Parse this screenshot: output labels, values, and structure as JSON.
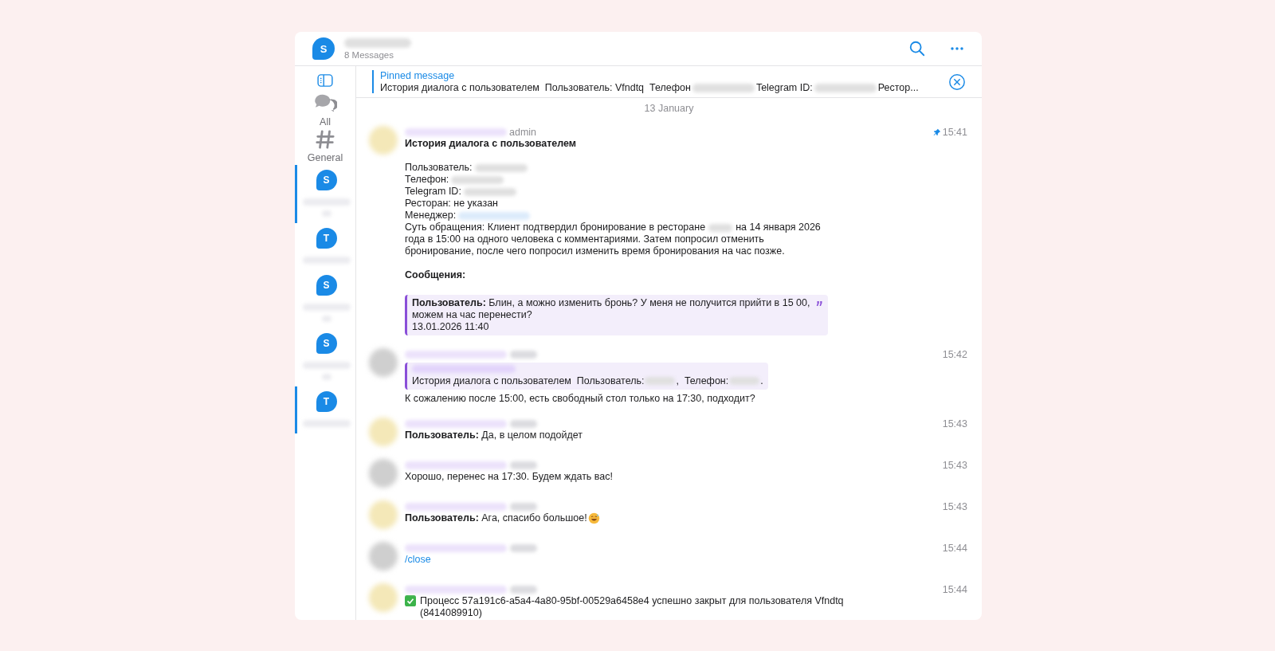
{
  "header": {
    "avatar_letter": "S",
    "subtitle": "8 Messages"
  },
  "sidebar": {
    "filters": [
      {
        "kind": "all",
        "label": "All"
      },
      {
        "kind": "general",
        "label": "General"
      }
    ],
    "topics": [
      {
        "letter": "S",
        "selected": true,
        "kind": "double"
      },
      {
        "letter": "T",
        "selected": false,
        "kind": "single"
      },
      {
        "letter": "S",
        "selected": false,
        "kind": "double"
      },
      {
        "letter": "S",
        "selected": false,
        "kind": "double"
      },
      {
        "letter": "T",
        "selected": true,
        "kind": "single"
      }
    ]
  },
  "pinned": {
    "label": "Pinned message",
    "segments": [
      "История диалога с пользователем  Пользователь: Vfndtq  Телефон",
      "Telegram ID:",
      "Рестор..."
    ]
  },
  "date_separator": "13 January",
  "messages": [
    {
      "color": "#f4e8b8",
      "role": "admin",
      "time": "15:41",
      "pinned": true,
      "body": [
        {
          "kind": "bold",
          "text": "История диалога с пользователем"
        },
        {
          "kind": "gap"
        },
        {
          "kind": "field",
          "text": "Пользователь:"
        },
        {
          "kind": "field",
          "text": "Телефон:"
        },
        {
          "kind": "field",
          "text": "Telegram ID:"
        },
        {
          "kind": "text",
          "text": "Ресторан: не указан"
        },
        {
          "kind": "field-link",
          "text": "Менеджер:"
        },
        {
          "kind": "split",
          "before": "Суть обращения: Клиент подтвердил бронирование в ресторане",
          "after": "на 14 января 2026",
          "continued": "года в 15:00 на одного человека с комментариями. Затем попросил отменить бронирование, после чего попросил изменить время бронирования на час позже."
        },
        {
          "kind": "gap"
        },
        {
          "kind": "bold",
          "text": "Сообщения:"
        },
        {
          "kind": "gap"
        },
        {
          "kind": "quote",
          "text": "**Пользователь:** Блин, а можно изменить бронь? У меня не получится прийти в 15 00, можем на час перенести?",
          "date": "13.01.2026 11:40"
        }
      ]
    },
    {
      "color": "#cfcfcf",
      "time": "15:42",
      "pinned": false,
      "reply": {
        "segments": [
          "История диалога с пользователем  Пользователь:",
          ",  Телефон:",
          "."
        ]
      },
      "body": [
        {
          "kind": "text",
          "text": "К сожалению после 15:00, есть свободный стол только на 17:30, подходит?"
        }
      ]
    },
    {
      "color": "#f4e8b8",
      "time": "15:43",
      "pinned": false,
      "body": [
        {
          "kind": "rich",
          "text": "**Пользователь:** Да, в целом подойдет"
        }
      ]
    },
    {
      "color": "#cfcfcf",
      "time": "15:43",
      "pinned": false,
      "body": [
        {
          "kind": "text",
          "text": "Хорошо, перенес на 17:30. Будем ждать вас!"
        }
      ]
    },
    {
      "color": "#f4e8b8",
      "time": "15:43",
      "pinned": false,
      "body": [
        {
          "kind": "emoji",
          "text": "**Пользователь:** Ага, спасибо большое!"
        }
      ]
    },
    {
      "color": "#cfcfcf",
      "time": "15:44",
      "pinned": false,
      "body": [
        {
          "kind": "link",
          "text": "/close"
        }
      ]
    },
    {
      "color": "#f4e8b8",
      "time": "15:44",
      "pinned": false,
      "body": [
        {
          "kind": "check",
          "text": "Процесс 57a191c6-a5a4-4a80-95bf-00529a6458e4 успешно закрыт для пользователя Vfndtq (8414089910)"
        }
      ]
    }
  ]
}
